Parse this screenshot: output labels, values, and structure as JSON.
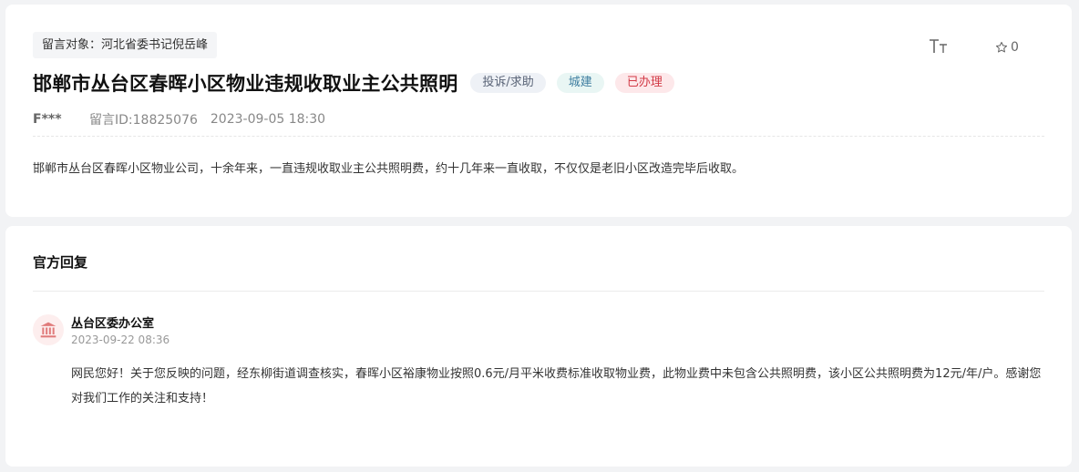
{
  "message": {
    "target_label": "留言对象：河北省委书记倪岳峰",
    "title": "邯郸市丛台区春晖小区物业违规收取业主公共照明",
    "tags": {
      "type": "投诉/求助",
      "field": "城建",
      "status": "已办理"
    },
    "author": "F***",
    "message_id": "留言ID:18825076",
    "datetime": "2023-09-05 18:30",
    "content": "邯郸市丛台区春晖小区物业公司，十余年来，一直违规收取业主公共照明费，约十几年来一直收取，不仅仅是老旧小区改造完毕后收取。",
    "favorite_count": "0"
  },
  "toolbar": {
    "font_size_icon": "font-size-icon",
    "favorite_icon": "star-icon"
  },
  "reply": {
    "heading": "官方回复",
    "org_icon": "government-building-icon",
    "org_name": "丛台区委办公室",
    "datetime": "2023-09-22 08:36",
    "content": "网民您好！关于您反映的问题，经东柳街道调查核实，春晖小区裕康物业按照0.6元/月平米收费标准收取物业费，此物业费中未包含公共照明费，该小区公共照明费为12元/年/户。感谢您对我们工作的关注和支持！"
  },
  "colors": {
    "background": "#f2f3f5",
    "status_tag_text": "#d23a46",
    "status_tag_bg": "#fde8ea",
    "field_tag_text": "#3f7ea0",
    "field_tag_bg": "#e9f6f4",
    "org_icon": "#e07b7b"
  }
}
